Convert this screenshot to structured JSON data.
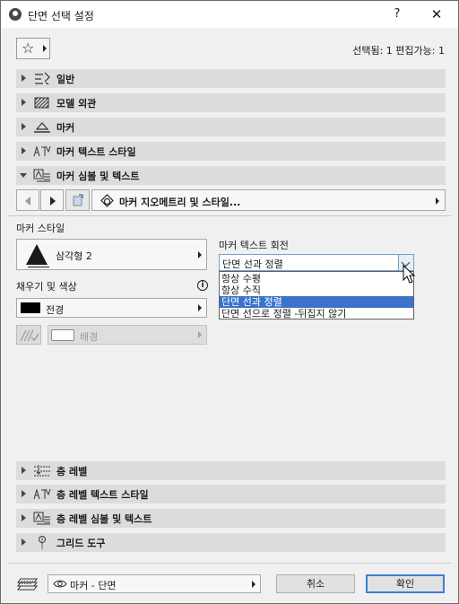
{
  "window": {
    "title": "단면 선택 설정",
    "help_label": "?",
    "close_label": "✕"
  },
  "header": {
    "favorites_icon": "star-icon",
    "selection_info": "선택됨: 1 편집가능: 1"
  },
  "panels": [
    {
      "label": "일반",
      "expanded": false,
      "icon": "general-settings-icon"
    },
    {
      "label": "모델 외관",
      "expanded": false,
      "icon": "model-appearance-icon"
    },
    {
      "label": "마커",
      "expanded": false,
      "icon": "marker-icon"
    },
    {
      "label": "마커 텍스트 스타일",
      "expanded": false,
      "icon": "text-style-icon"
    },
    {
      "label": "마커 심볼 및 텍스트",
      "expanded": true,
      "icon": "symbol-text-icon"
    }
  ],
  "panels_bottom": [
    {
      "label": "층 레벨",
      "expanded": false,
      "icon": "story-level-icon"
    },
    {
      "label": "층 레벨 텍스트 스타일",
      "expanded": false,
      "icon": "text-style-icon"
    },
    {
      "label": "층 레벨 심볼 및 텍스트",
      "expanded": false,
      "icon": "symbol-text-icon"
    },
    {
      "label": "그리드 도구",
      "expanded": false,
      "icon": "grid-tool-icon"
    }
  ],
  "nav": {
    "page_label": "마커 지오메트리 및 스타일..."
  },
  "marker_style": {
    "section_label": "마커 스타일",
    "shape_label": "삼각형 2"
  },
  "fill_color": {
    "section_label": "채우기 및 색상",
    "info_icon": "i",
    "foreground_label": "전경",
    "foreground_color": "#000000",
    "background_label": "배경",
    "background_color": "#ffffff"
  },
  "text_rotation": {
    "label": "마커 텍스트 회전",
    "selected": "단면 선과 정렬",
    "options": [
      "항상 수평",
      "항상 수직",
      "단면 선과 정렬",
      "단면 선으로 정렬 -뒤집지 않기"
    ],
    "highlighted_index": 2
  },
  "footer": {
    "layer_label": "마커 - 단면",
    "cancel_label": "취소",
    "ok_label": "확인"
  },
  "colors": {
    "accent": "#3a73c9",
    "panel_bg": "#dcdcdc"
  }
}
